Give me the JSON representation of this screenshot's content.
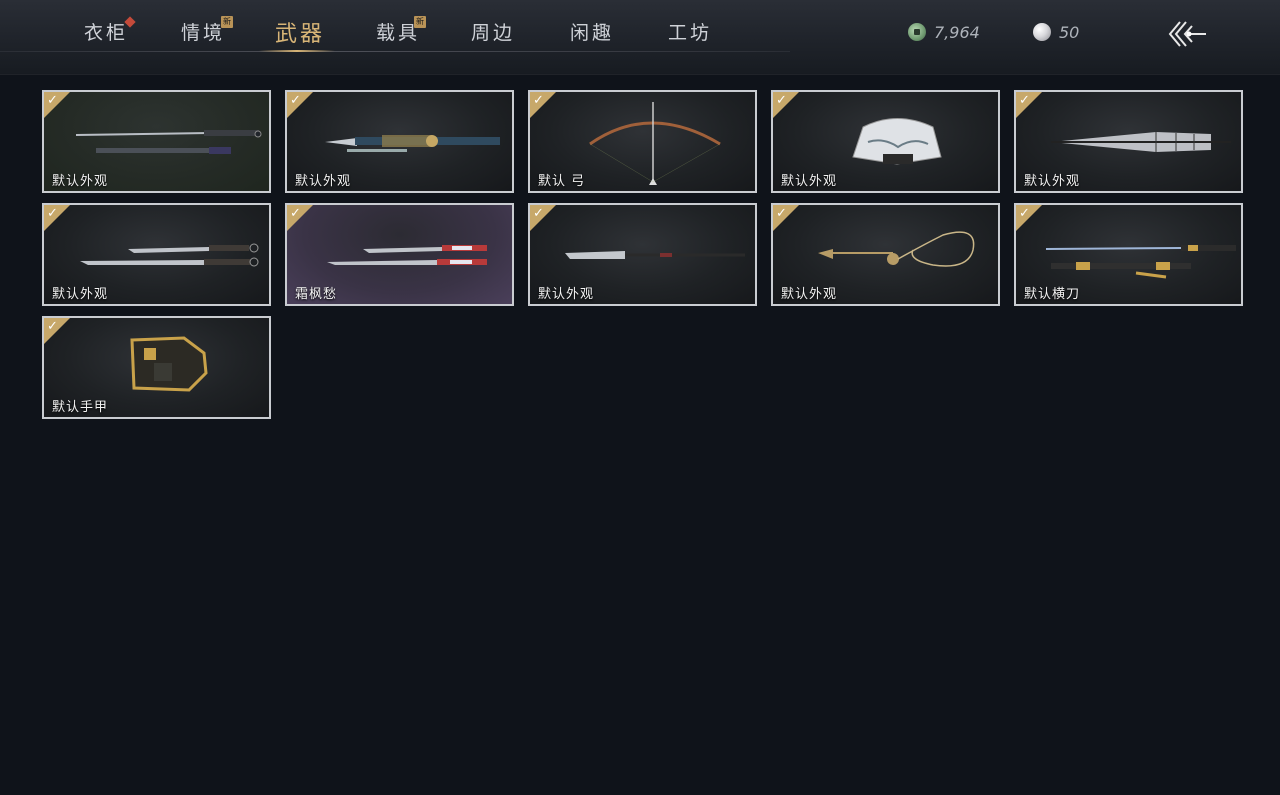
{
  "tabs": [
    {
      "label": "衣柜",
      "marker": "red-diamond"
    },
    {
      "label": "情境",
      "badge": "新"
    },
    {
      "label": "武器",
      "active": true
    },
    {
      "label": "载具",
      "badge": "新"
    },
    {
      "label": "周边"
    },
    {
      "label": "闲趣"
    },
    {
      "label": "工坊"
    }
  ],
  "currency": {
    "jade": {
      "icon": "jade-coin-icon",
      "value": "7,964"
    },
    "pearl": {
      "icon": "pearl-icon",
      "value": "50"
    }
  },
  "back": {
    "icon": "back-arrow-icon"
  },
  "colors": {
    "accent": "#d8b577",
    "check": "#c7a86a",
    "card_border": "#c9ccd1",
    "bg": "#0f131a"
  },
  "items": [
    {
      "label": "默认外观",
      "weapon": "sword-icon",
      "equipped": true
    },
    {
      "label": "默认外观",
      "weapon": "spear-icon",
      "equipped": true
    },
    {
      "label": "默认 弓",
      "weapon": "bow-icon",
      "equipped": true
    },
    {
      "label": "默认外观",
      "weapon": "fan-icon",
      "equipped": true
    },
    {
      "label": "默认外观",
      "weapon": "umbrella-icon",
      "equipped": true
    },
    {
      "label": "默认外观",
      "weapon": "dual-blades-icon",
      "equipped": true
    },
    {
      "label": "霜枫愁",
      "weapon": "dual-blades-icon",
      "equipped": true
    },
    {
      "label": "默认外观",
      "weapon": "glaive-icon",
      "equipped": true
    },
    {
      "label": "默认外观",
      "weapon": "rope-dart-icon",
      "equipped": true
    },
    {
      "label": "默认横刀",
      "weapon": "hengdao-icon",
      "equipped": true
    },
    {
      "label": "默认手甲",
      "weapon": "gauntlet-icon",
      "equipped": true
    }
  ]
}
